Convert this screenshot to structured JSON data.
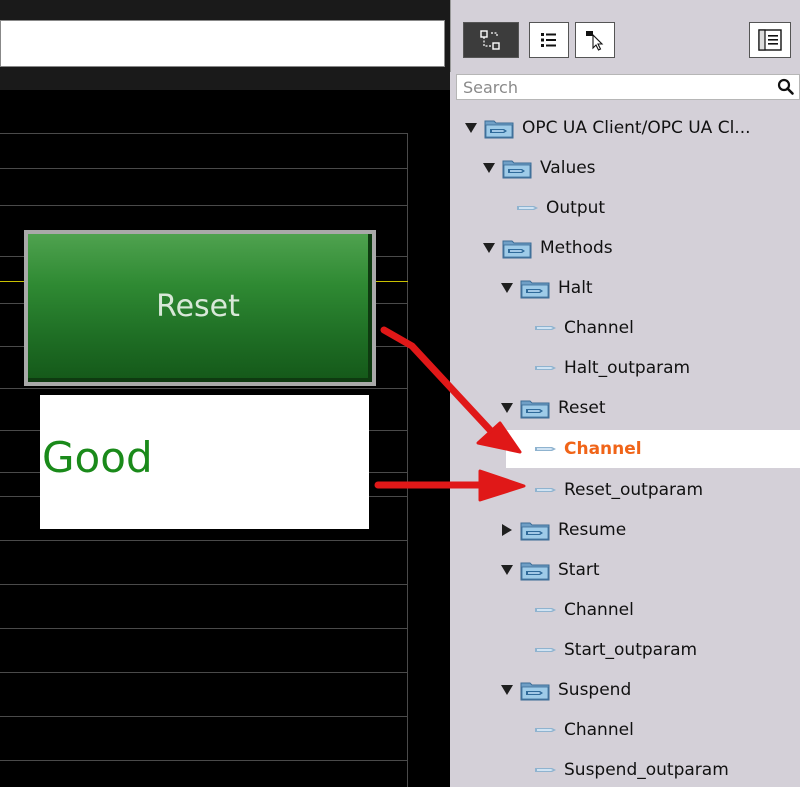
{
  "canvas": {
    "reset_button_label": "Reset",
    "status_value": "Good",
    "status_color": "#1a8a1a"
  },
  "toolbar": {
    "buttons": [
      "tree-view-icon",
      "list-view-icon",
      "pointer-select-icon",
      "properties-panel-icon"
    ]
  },
  "search": {
    "placeholder": "Search"
  },
  "tree": {
    "root": "OPC UA Client/OPC UA Cl...",
    "values_folder": "Values",
    "values_output": "Output",
    "methods_folder": "Methods",
    "halt_folder": "Halt",
    "halt_channel": "Channel",
    "halt_outparam": "Halt_outparam",
    "reset_folder": "Reset",
    "reset_channel": "Channel",
    "reset_outparam": "Reset_outparam",
    "resume_folder": "Resume",
    "start_folder": "Start",
    "start_channel": "Channel",
    "start_outparam": "Start_outparam",
    "suspend_folder": "Suspend",
    "suspend_channel": "Channel",
    "suspend_outparam": "Suspend_outparam"
  },
  "colors": {
    "selected_text": "#f06418",
    "arrow": "#e01818",
    "panel_bg": "#d4d0d8"
  }
}
